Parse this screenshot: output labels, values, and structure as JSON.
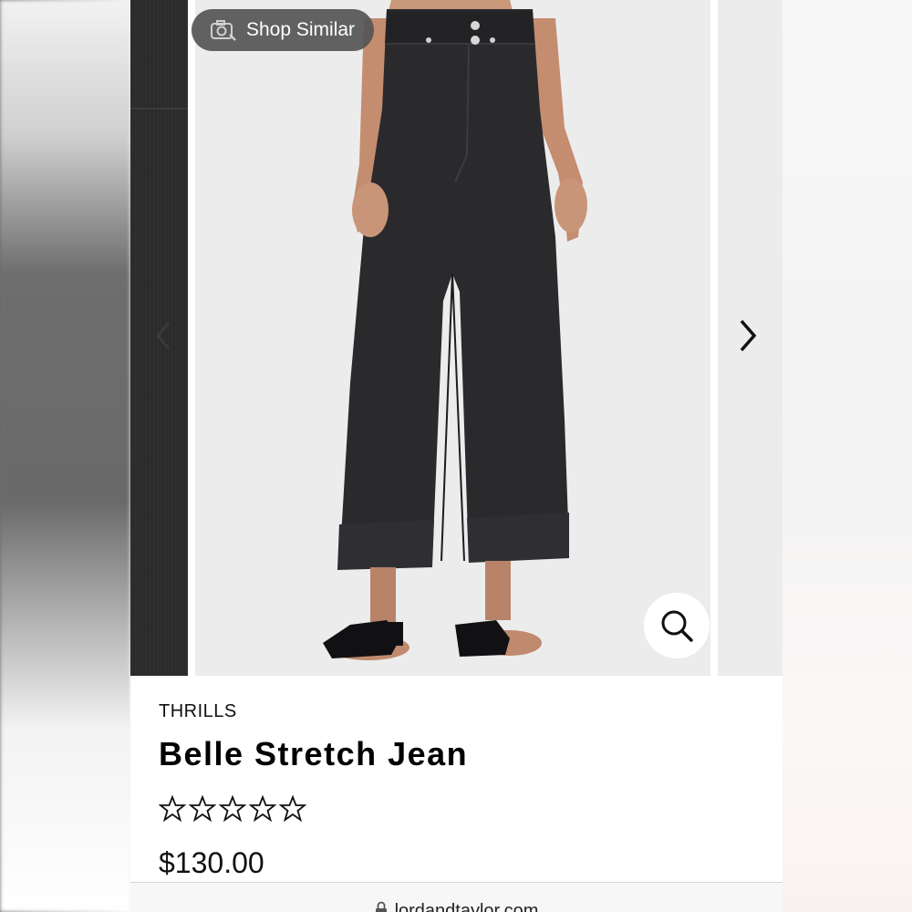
{
  "carousel": {
    "shop_similar_label": "Shop Similar",
    "camera_icon": "camera-search-icon",
    "prev_icon": "chevron-left-icon",
    "next_icon": "chevron-right-icon",
    "zoom_icon": "search-icon",
    "image_alt": "Model wearing black wide-leg cropped jeans with black mule sandals"
  },
  "product": {
    "brand": "THRILLS",
    "name": "Belle Stretch Jean",
    "rating": 0,
    "rating_max": 5,
    "price": "$130.00"
  },
  "browser": {
    "url": "lordandtaylor.com",
    "lock_icon": "lock-icon"
  },
  "colors": {
    "denim": "#2a2a2d",
    "overlay": "#555555",
    "text": "#111111"
  }
}
